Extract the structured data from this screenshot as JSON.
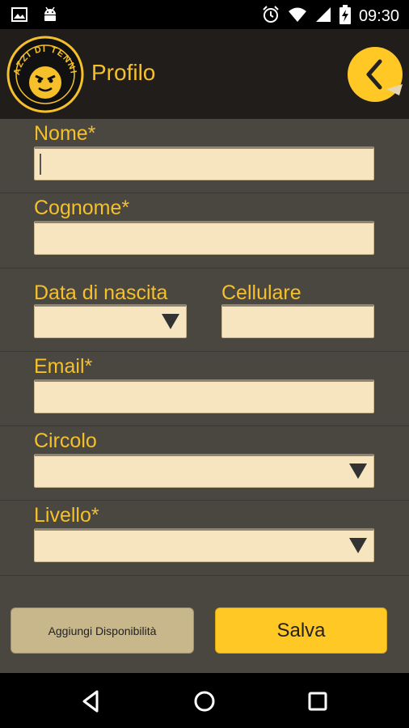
{
  "status_bar": {
    "time": "09:30",
    "icons": [
      "image-icon",
      "android-icon",
      "alarm-icon",
      "wifi-icon",
      "signal-icon",
      "battery-charging-icon"
    ]
  },
  "header": {
    "title": "Profilo",
    "logo_text": "PAZZI DI TENNIS",
    "back_icon": "chevron-left-icon"
  },
  "form": {
    "nome": {
      "label": "Nome*",
      "value": ""
    },
    "cognome": {
      "label": "Cognome*",
      "value": ""
    },
    "data_nascita": {
      "label": "Data di nascita",
      "value": ""
    },
    "cellulare": {
      "label": "Cellulare",
      "value": ""
    },
    "email": {
      "label": "Email*",
      "value": ""
    },
    "circolo": {
      "label": "Circolo",
      "value": ""
    },
    "livello": {
      "label": "Livello*",
      "value": ""
    }
  },
  "buttons": {
    "aggiungi": "Aggiungi Disponibilità",
    "salva": "Salva"
  },
  "nav_bar": {
    "icons": [
      "back-triangle-icon",
      "home-circle-icon",
      "recents-square-icon"
    ]
  },
  "colors": {
    "accent": "#f5c02a",
    "header_bg": "#201d1b",
    "form_bg": "#4a4640",
    "field_bg": "#f6e5bf",
    "secondary_button": "#c8b78b",
    "primary_button": "#ffc825"
  }
}
